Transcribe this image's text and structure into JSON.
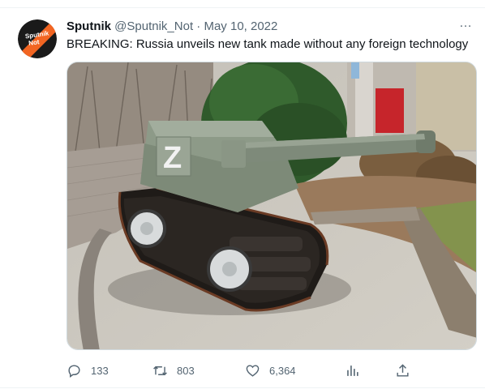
{
  "tweet": {
    "display_name": "Sputnik",
    "handle": "@Sputnik_Not",
    "separator": " · ",
    "date": "May 10, 2022",
    "avatar_text": [
      "Sputnik",
      "Not"
    ],
    "text": "BREAKING: Russia unveils new tank made without any foreign technology",
    "more_icon": "…",
    "image_badge": "Z"
  },
  "actions": {
    "replies": "133",
    "retweets": "803",
    "likes": "6,364"
  },
  "icons": [
    "reply-icon",
    "retweet-icon",
    "like-icon",
    "views-icon",
    "share-icon"
  ],
  "colors": {
    "brand": "#f26522",
    "muted": "#536471",
    "text": "#0f1419"
  }
}
